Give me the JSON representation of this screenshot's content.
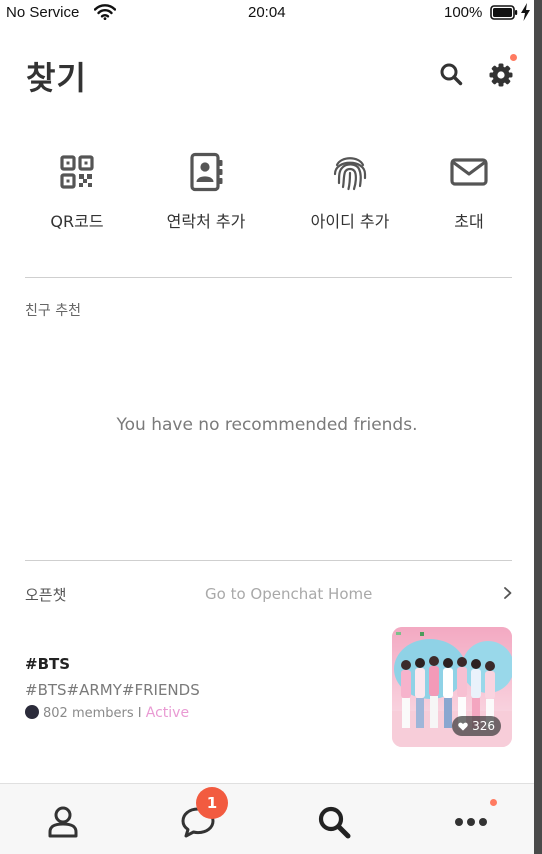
{
  "status_bar": {
    "carrier": "No Service",
    "time": "20:04",
    "battery": "100%"
  },
  "header": {
    "title": "찾기"
  },
  "quick_actions": [
    {
      "label": "QR코드",
      "icon": "qr-code-icon"
    },
    {
      "label": "연락처 추가",
      "icon": "contacts-book-icon"
    },
    {
      "label": "아이디 추가",
      "icon": "fingerprint-icon"
    },
    {
      "label": "초대",
      "icon": "envelope-icon"
    }
  ],
  "recommended": {
    "label": "친구 추천",
    "empty_message": "You have no recommended friends."
  },
  "openchat": {
    "label": "오픈챗",
    "home_link": "Go to Openchat Home",
    "card": {
      "title": "#BTS",
      "tags": "#BTS#ARMY#FRIENDS",
      "members": "802 members",
      "separator": "I",
      "status": "Active",
      "likes": "326"
    }
  },
  "tab_bar": {
    "items": [
      "friends-icon",
      "chat-bubble-icon",
      "search-icon",
      "more-icon"
    ],
    "chat_badge": "1"
  },
  "colors": {
    "accent_badge": "#f25b40",
    "notification_dot": "#ff7b61",
    "active_status": "#e99ad3",
    "icon_gray": "#555555"
  }
}
